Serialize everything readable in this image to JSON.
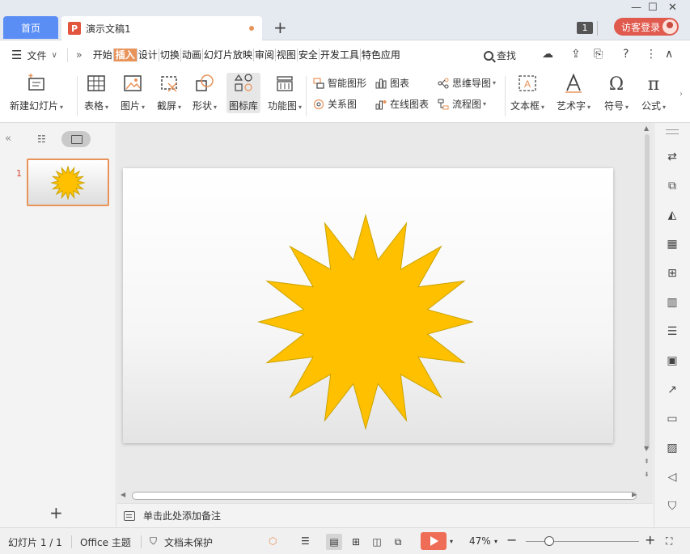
{
  "titlebar": {
    "home_tab": "首页",
    "doc_tab": "演示文稿1",
    "doc_icon_letter": "P",
    "add_tab": "+",
    "notification_count": "1",
    "guest_login": "访客登录"
  },
  "menubar": {
    "file_label": "文件",
    "tabs": [
      "开始",
      "插入",
      "设计",
      "切换",
      "动画",
      "幻灯片放映",
      "审阅",
      "视图",
      "安全",
      "开发工具",
      "特色应用"
    ],
    "active_tab": "插入",
    "search_label": "查找"
  },
  "ribbon": {
    "new_slide": "新建幻灯片",
    "table": "表格",
    "picture": "图片",
    "screenshot": "截屏",
    "shape": "形状",
    "icon_library": "图标库",
    "function_chart": "功能图",
    "smart_shape": "智能图形",
    "chart": "图表",
    "relation_chart": "关系图",
    "online_chart": "在线图表",
    "mind_map": "思维导图",
    "flowchart": "流程图",
    "textbox": "文本框",
    "art_text": "艺术字",
    "symbol": "符号",
    "formula": "公式"
  },
  "left_panel": {
    "slide_number": "1",
    "add_slide": "+"
  },
  "notes": {
    "placeholder": "单击此处添加备注"
  },
  "statusbar": {
    "slide_info": "幻灯片 1 / 1",
    "theme": "Office 主题",
    "protection": "文档未保护",
    "zoom": "47%",
    "zoom_out": "−",
    "zoom_in": "+"
  },
  "colors": {
    "accent": "#e8935a",
    "home_tab": "#5a8ef5",
    "guest_button": "#e05a4e",
    "star_fill": "#ffc000",
    "star_stroke": "#c9a300",
    "play_button": "#ef6c57"
  },
  "icons": {
    "right_sidebar": [
      "select-icon",
      "shape-icon",
      "fill-icon",
      "table-icon",
      "grid-icon",
      "chart-icon",
      "settings-icon",
      "picture-icon",
      "share-icon",
      "archive-icon",
      "image-icon",
      "audio-icon",
      "shield-icon"
    ]
  }
}
